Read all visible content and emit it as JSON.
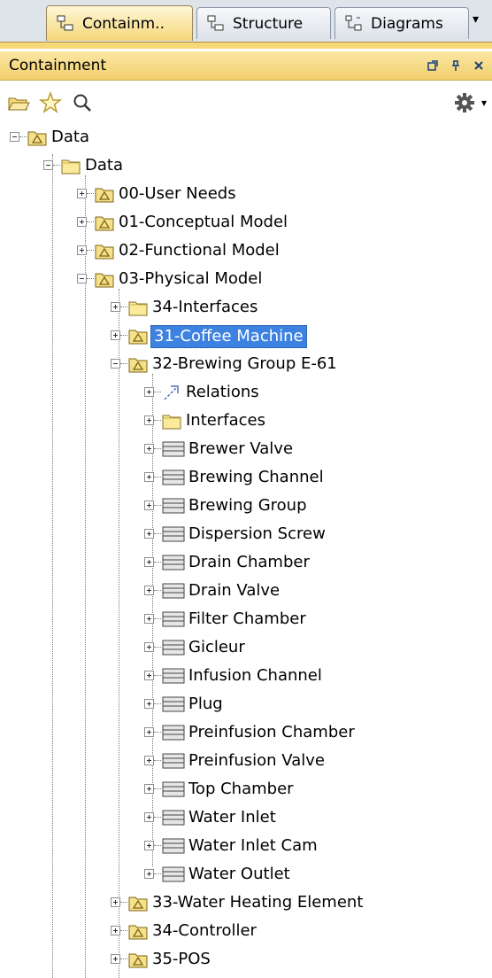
{
  "tabs": [
    {
      "label": "Containm..",
      "icon": "containment-tree-icon",
      "active": true
    },
    {
      "label": "Structure",
      "icon": "structure-icon",
      "active": false
    },
    {
      "label": "Diagrams",
      "icon": "diagrams-icon",
      "active": false
    }
  ],
  "panel": {
    "title": "Containment",
    "buttons": [
      "float-icon",
      "pin-icon",
      "close-icon"
    ]
  },
  "toolbar": {
    "tools": [
      "open-folder-icon",
      "star-icon",
      "search-icon"
    ],
    "options": "gear-icon"
  },
  "tree": [
    {
      "label": "Data",
      "level": 0,
      "icon": "package",
      "expander": "minus"
    },
    {
      "label": "Data",
      "level": 1,
      "icon": "folder",
      "expander": "minus"
    },
    {
      "label": "00-User Needs",
      "level": 2,
      "icon": "package",
      "expander": "plus"
    },
    {
      "label": "01-Conceptual Model",
      "level": 2,
      "icon": "package",
      "expander": "plus"
    },
    {
      "label": "02-Functional Model",
      "level": 2,
      "icon": "package",
      "expander": "plus"
    },
    {
      "label": "03-Physical Model",
      "level": 2,
      "icon": "package",
      "expander": "minus"
    },
    {
      "label": "34-Interfaces",
      "level": 3,
      "icon": "folder",
      "expander": "plus"
    },
    {
      "label": "31-Coffee Machine",
      "level": 3,
      "icon": "package",
      "expander": "plus",
      "selected": true
    },
    {
      "label": "32-Brewing Group E-61",
      "level": 3,
      "icon": "package",
      "expander": "minus"
    },
    {
      "label": "Relations",
      "level": 4,
      "icon": "relation",
      "expander": "plus"
    },
    {
      "label": "Interfaces",
      "level": 4,
      "icon": "folder",
      "expander": "plus"
    },
    {
      "label": "Brewer Valve",
      "level": 4,
      "icon": "block",
      "expander": "plus"
    },
    {
      "label": "Brewing Channel",
      "level": 4,
      "icon": "block",
      "expander": "plus"
    },
    {
      "label": "Brewing Group",
      "level": 4,
      "icon": "block",
      "expander": "plus"
    },
    {
      "label": "Dispersion Screw",
      "level": 4,
      "icon": "block",
      "expander": "plus"
    },
    {
      "label": "Drain Chamber",
      "level": 4,
      "icon": "block",
      "expander": "plus"
    },
    {
      "label": "Drain Valve",
      "level": 4,
      "icon": "block",
      "expander": "plus"
    },
    {
      "label": "Filter Chamber",
      "level": 4,
      "icon": "block",
      "expander": "plus"
    },
    {
      "label": "Gicleur",
      "level": 4,
      "icon": "block",
      "expander": "plus"
    },
    {
      "label": "Infusion Channel",
      "level": 4,
      "icon": "block",
      "expander": "plus"
    },
    {
      "label": "Plug",
      "level": 4,
      "icon": "block",
      "expander": "plus"
    },
    {
      "label": "Preinfusion Chamber",
      "level": 4,
      "icon": "block",
      "expander": "plus"
    },
    {
      "label": "Preinfusion Valve",
      "level": 4,
      "icon": "block",
      "expander": "plus"
    },
    {
      "label": "Top Chamber",
      "level": 4,
      "icon": "block",
      "expander": "plus"
    },
    {
      "label": "Water Inlet",
      "level": 4,
      "icon": "block",
      "expander": "plus"
    },
    {
      "label": "Water Inlet Cam",
      "level": 4,
      "icon": "block",
      "expander": "plus"
    },
    {
      "label": "Water Outlet",
      "level": 4,
      "icon": "block",
      "expander": "plus"
    },
    {
      "label": "33-Water Heating Element",
      "level": 3,
      "icon": "package",
      "expander": "plus"
    },
    {
      "label": "34-Controller",
      "level": 3,
      "icon": "package",
      "expander": "plus"
    },
    {
      "label": "35-POS",
      "level": 3,
      "icon": "package",
      "expander": "plus"
    }
  ],
  "colors": {
    "selection": "#3d82e0",
    "title_bar": "#f1cf6c",
    "package_yellow": "#f6e08a"
  }
}
